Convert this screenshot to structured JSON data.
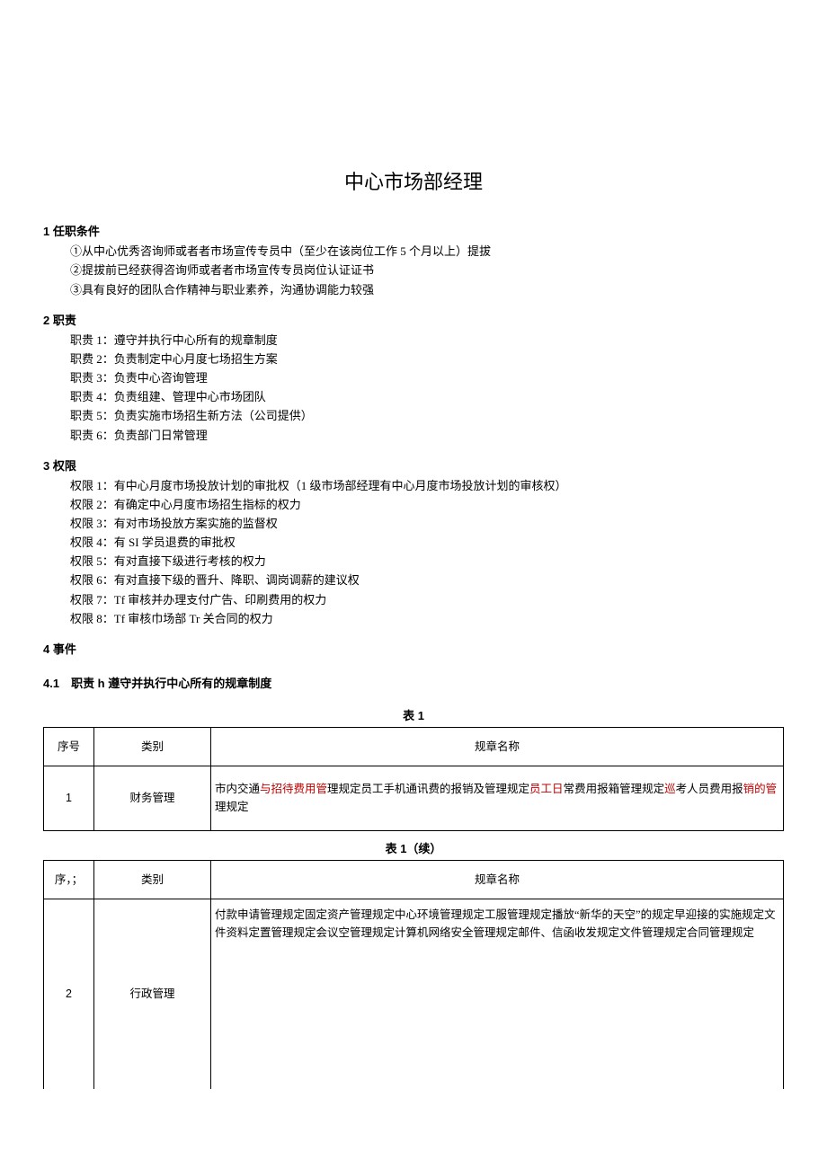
{
  "title": "中心市场部经理",
  "sections": {
    "s1": {
      "heading": "1 任职条件",
      "items": [
        "①从中心优秀咨询师或者者市场宣传专员中（至少在该岗位工作 5 个月以上）提拔",
        "②提拔前已经获得咨询师或者者市场宣传专员岗位认证证书",
        "③具有良好的团队合作精神与职业素养，沟通协调能力较强"
      ]
    },
    "s2": {
      "heading": "2 职责",
      "items": [
        "职贵 1：遵守并执行中心所有的规章制度",
        "职费 2：负责制定中心月度七场招生方案",
        "职责 3：负责中心咨询管理",
        "职责 4：负责组建、管理中心市场团队",
        "职责 5：负责实施市场招生新方法（公司提供）",
        "职责 6：负责部门日常管理"
      ]
    },
    "s3": {
      "heading": "3 权限",
      "items": [
        "权限 1：有中心月度市场投放计划的审批权（1 级市场部经理有中心月度市场投放计划的审核权）",
        "权限 2：有确定中心月度市场招生指标的权力",
        "权限 3：有对市场投放方案实施的监督权",
        "权限 4：有 SI 学员退费的审批权",
        "权限 5：有对直接下级进行考核的权力",
        "权限 6：有对直接下级的晋升、降职、调岗调薪的建议权",
        "权限 7：Tf 审核并办理支付广告、印刷费用的权力",
        "权限 8：Tf 审核巾场部 Tr 关合同的权力"
      ]
    },
    "s4": {
      "heading": "4 事件"
    },
    "s41": {
      "heading": "4.1　职责 h 遵守并执行中心所有的规章制度"
    }
  },
  "table1": {
    "caption": "表 1",
    "head": {
      "c1": "序号",
      "c2": "类别",
      "c3": "规章名称"
    },
    "row": {
      "seq": "1",
      "cat": "财务管理",
      "cell_parts": {
        "p1": "市内交通",
        "p2_red": "与招待费用管",
        "p3": "理规定员工手机通讯费的报销及管理规定",
        "p4_red": "员工日",
        "p5": "常费用报箱管理规定",
        "p6_red": "巡",
        "p7": "考人员费用报",
        "p8_red": "销的管",
        "p9": "理规定"
      }
    }
  },
  "table1c": {
    "caption": "表 1（续）",
    "head": {
      "c1": "序，；",
      "c2": "类别",
      "c3": "规章名称"
    },
    "row": {
      "seq": "2",
      "cat": "行政管理",
      "text": "付款申请管理规定固定资产管理规定中心环境管理规定工服管理规定播放“新华的天空”的规定早迎接的实施规定文件资料定置管理规定会议空管理规定计算机网络安全管理规定邮件、信函收发规定文件管理规定合同管理规定"
    }
  }
}
